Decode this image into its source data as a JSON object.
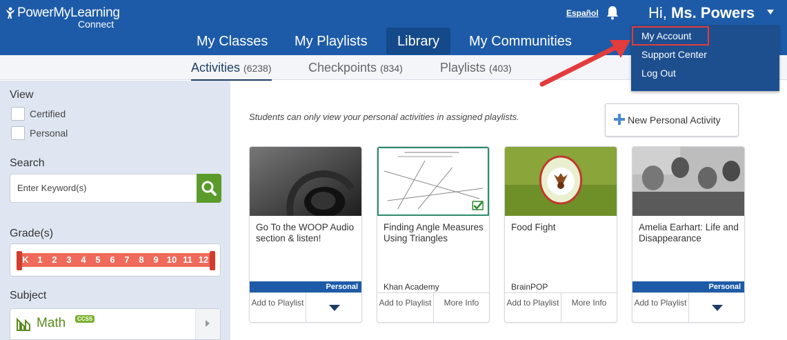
{
  "header": {
    "logo_main": "PowerMyLearning",
    "logo_sub": "Connect",
    "language_link": "Español",
    "greeting_prefix": "Hi,",
    "user_name": "Ms. Powers"
  },
  "main_nav": [
    {
      "label": "My Classes",
      "active": false
    },
    {
      "label": "My Playlists",
      "active": false
    },
    {
      "label": "Library",
      "active": true
    },
    {
      "label": "My Communities",
      "active": false
    }
  ],
  "sub_nav": [
    {
      "label": "Activities",
      "count": "(6238)",
      "active": true
    },
    {
      "label": "Checkpoints",
      "count": "(834)",
      "active": false
    },
    {
      "label": "Playlists",
      "count": "(403)",
      "active": false
    }
  ],
  "account_menu": [
    {
      "label": "My Account",
      "highlighted": true
    },
    {
      "label": "Support Center"
    },
    {
      "label": "Log Out"
    }
  ],
  "sidebar": {
    "view_heading": "View",
    "view_options": [
      "Certified",
      "Personal"
    ],
    "search_heading": "Search",
    "search_placeholder": "Enter Keyword(s)",
    "grade_heading": "Grade(s)",
    "grades": [
      "K",
      "1",
      "2",
      "3",
      "4",
      "5",
      "6",
      "7",
      "8",
      "9",
      "10",
      "11",
      "12"
    ],
    "subject_heading": "Subject",
    "subject_label": "Math",
    "subject_badge": "CCSS"
  },
  "main": {
    "notice": "Students can only view your personal activities in assigned playlists.",
    "new_activity_label": "New Personal Activity",
    "cards": [
      {
        "title": "Go To the WOOP Audio section & listen!",
        "badge": "Personal",
        "source": "",
        "left_action": "Add to Playlist",
        "right_action": ""
      },
      {
        "title": "Finding Angle Measures Using Triangles",
        "badge": "",
        "source": "Khan Academy",
        "left_action": "Add to Playlist",
        "right_action": "More Info"
      },
      {
        "title": "Food Fight",
        "badge": "",
        "source": "BrainPOP",
        "left_action": "Add to Playlist",
        "right_action": "More Info"
      },
      {
        "title": "Amelia Earhart: Life and Disappearance",
        "badge": "Personal",
        "source": "",
        "left_action": "Add to Playlist",
        "right_action": ""
      }
    ]
  },
  "colors": {
    "header_blue": "#1d5ba8",
    "active_nav": "#144a8a",
    "sidebar_bg": "#dfe6f2",
    "search_green": "#5a9b2b",
    "grade_red": "#ef6a5a",
    "highlight_red": "#e23c3c"
  }
}
